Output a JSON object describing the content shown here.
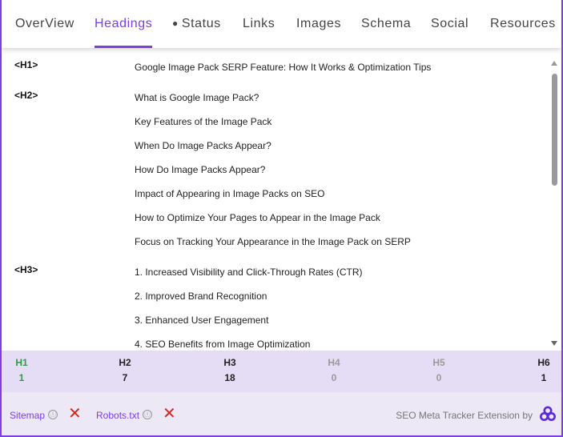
{
  "tabs": [
    {
      "label": "OverView"
    },
    {
      "label": "Headings"
    },
    {
      "label": "Status"
    },
    {
      "label": "Links"
    },
    {
      "label": "Images"
    },
    {
      "label": "Schema"
    },
    {
      "label": "Social"
    },
    {
      "label": "Resources"
    }
  ],
  "active_tab": "Headings",
  "accent_color": "#7b3fe4",
  "headings": {
    "h1_tag": "<H1>",
    "h1": [
      "Google Image Pack SERP Feature: How It Works & Optimization Tips"
    ],
    "h2_tag": "<H2>",
    "h2": [
      "What is Google Image Pack?",
      "Key Features of the Image Pack",
      "When Do Image Packs Appear?",
      "How Do Image Packs Appear?",
      "Impact of Appearing in Image Packs on SEO",
      "How to Optimize Your Pages to Appear in the Image Pack",
      "Focus on Tracking Your Appearance in the Image Pack on SERP"
    ],
    "h3_tag": "<H3>",
    "h3": [
      "1. Increased Visibility and Click-Through Rates (CTR)",
      "2. Improved Brand Recognition",
      "3. Enhanced User Engagement",
      "4. SEO Benefits from Image Optimization"
    ]
  },
  "counts": [
    {
      "label": "H1",
      "value": "1",
      "color": "#2e9e3e"
    },
    {
      "label": "H2",
      "value": "7",
      "color": "#222222"
    },
    {
      "label": "H3",
      "value": "18",
      "color": "#222222"
    },
    {
      "label": "H4",
      "value": "0",
      "color": "#9a9a9a"
    },
    {
      "label": "H5",
      "value": "0",
      "color": "#9a9a9a"
    },
    {
      "label": "H6",
      "value": "1",
      "color": "#222222"
    }
  ],
  "footer": {
    "sitemap_label": "Sitemap",
    "robots_label": "Robots.txt",
    "info_icon": "ⓘ",
    "status_icon": "✕",
    "brand_text": "SEO Meta Tracker Extension by"
  }
}
